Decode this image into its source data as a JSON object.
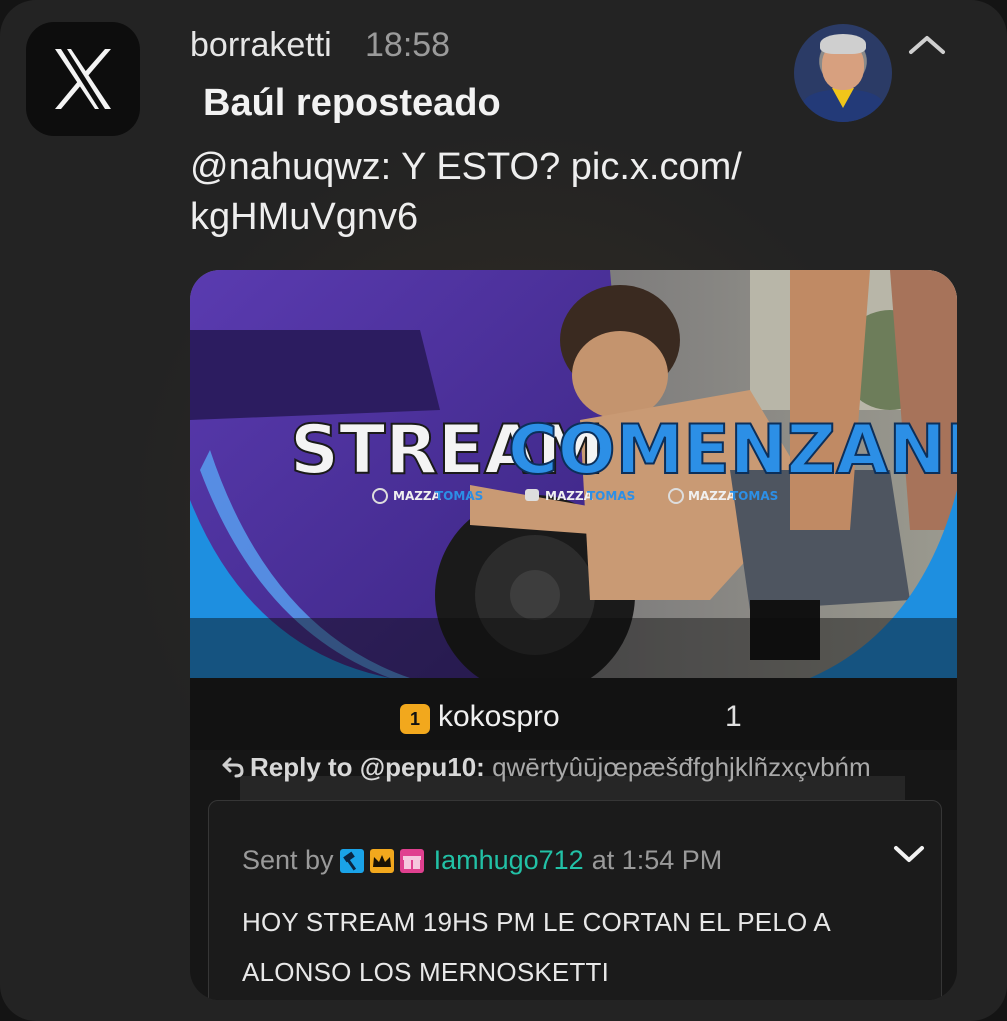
{
  "notification": {
    "app_icon": "x-logo-icon",
    "sender": "borraketti",
    "time": "18:58",
    "title": "Baúl reposteado",
    "body": "@nahuqwz: Y ESTO? pic.x.com/ kgHMuVgnv6",
    "collapse_icon": "chevron-up-icon"
  },
  "media": {
    "banner": {
      "headline_white": "STREAM",
      "headline_blue": "COMENZANDO",
      "socials": [
        {
          "icon": "instagram-icon",
          "name": "MAZZA",
          "suffix": "TOMAS"
        },
        {
          "icon": "youtube-icon",
          "name": "MAZZA",
          "suffix": "TOMAS"
        },
        {
          "icon": "tiktok-icon",
          "name": "MAZZA",
          "suffix": "TOMAS"
        }
      ]
    },
    "chat_bar": {
      "badge": "1",
      "username": "kokospro",
      "count": "1"
    },
    "reply": {
      "label": "Reply to @pepu10:",
      "text": "qwērtyûūjœpæšđfghjklñzxçvbńm"
    },
    "message": {
      "sent_by": "Sent by",
      "username": "Iamhugo712",
      "at_time": "at 1:54 PM",
      "text": "HOY STREAM 19HS PM LE CORTAN EL PELO A ALONSO LOS MERNOSKETTI",
      "expand_icon": "chevron-down-icon"
    }
  },
  "colors": {
    "accent_blue": "#1e8fe0",
    "username_teal": "#22c1a6",
    "badge_gold": "#f2a81d"
  }
}
